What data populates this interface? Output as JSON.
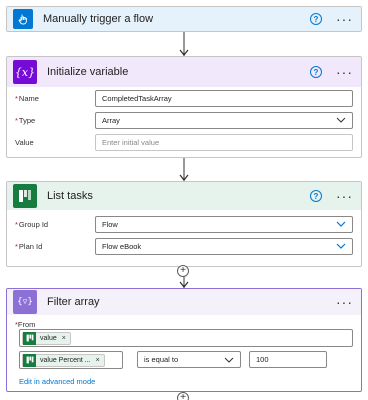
{
  "trigger": {
    "title": "Manually trigger a flow",
    "help": "?",
    "more": "···"
  },
  "init_variable": {
    "title": "Initialize variable",
    "help": "?",
    "more": "···",
    "fields": {
      "name": {
        "label": "Name",
        "value": "CompletedTaskArray"
      },
      "type": {
        "label": "Type",
        "value": "Array"
      },
      "value": {
        "label": "Value",
        "placeholder": "Enter initial value"
      }
    }
  },
  "list_tasks": {
    "title": "List tasks",
    "help": "?",
    "more": "···",
    "fields": {
      "group_id": {
        "label": "Group Id",
        "value": "Flow"
      },
      "plan_id": {
        "label": "Plan Id",
        "value": "Flow eBook"
      }
    }
  },
  "filter_array": {
    "title": "Filter array",
    "more": "···",
    "from_label": "From",
    "from_token": "value",
    "condition": {
      "left_token": "value Percent ...",
      "operator": "is equal to",
      "right_value": "100"
    },
    "advanced_link": "Edit in advanced mode"
  },
  "required_marker": "*",
  "add_step": "+",
  "remove_token": "×",
  "colors": {
    "trigger": "#0078d4",
    "variable": "#770bd6",
    "planner": "#177d3f",
    "filter": "#8c70d6",
    "link": "#0078d4"
  }
}
